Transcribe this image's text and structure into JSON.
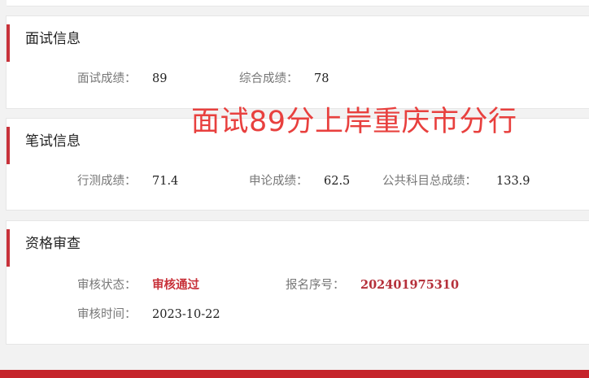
{
  "interview": {
    "title": "面试信息",
    "fields": [
      {
        "label": "面试成绩：",
        "value": "89"
      },
      {
        "label": "综合成绩：",
        "value": "78"
      }
    ]
  },
  "overlay": {
    "caption": "面试89分上岸重庆市分行"
  },
  "written": {
    "title": "笔试信息",
    "fields": [
      {
        "label": "行测成绩：",
        "value": "71.4"
      },
      {
        "label": "申论成绩：",
        "value": "62.5"
      },
      {
        "label": "公共科目总成绩：",
        "value": "133.9"
      }
    ]
  },
  "qualification": {
    "title": "资格审查",
    "fields": [
      {
        "label": "审核状态：",
        "value": "审核通过"
      },
      {
        "label": "报名序号：",
        "value": "202401975310"
      },
      {
        "label": "审核时间：",
        "value": "2023-10-22"
      }
    ]
  },
  "colors": {
    "accent": "#c8323a",
    "overlay_text": "#e8403e",
    "bottom_bar": "#c5242b"
  }
}
